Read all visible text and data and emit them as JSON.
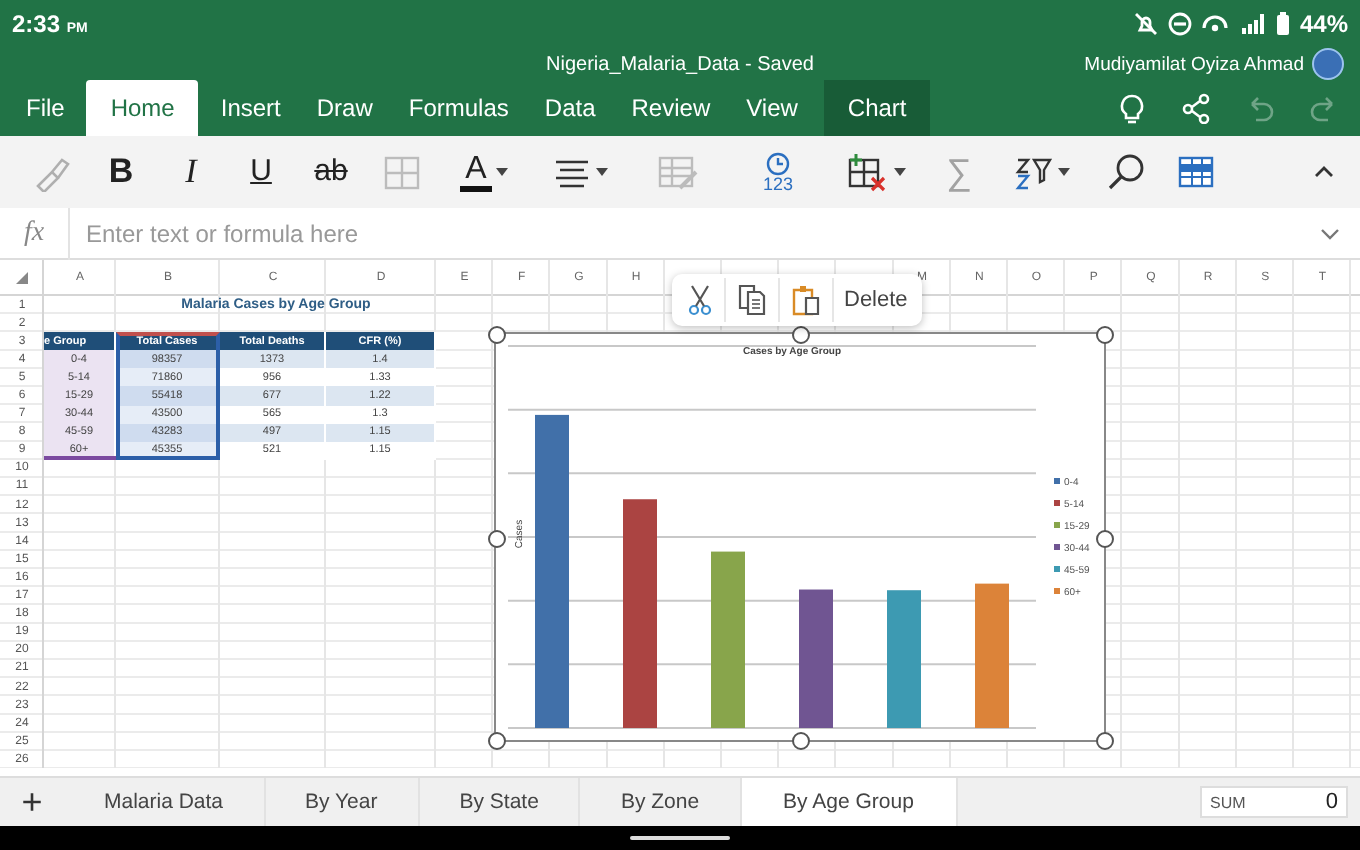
{
  "status_bar": {
    "time": "2:33",
    "meridiem": "PM",
    "battery": "44%"
  },
  "window": {
    "title": "Nigeria_Malaria_Data - Saved",
    "user": "Mudiyamilat Oyiza Ahmad"
  },
  "ribbon_tabs": [
    {
      "label": "File",
      "selected": false,
      "contextual": false
    },
    {
      "label": "Home",
      "selected": true,
      "contextual": false
    },
    {
      "label": "Insert",
      "selected": false,
      "contextual": false
    },
    {
      "label": "Draw",
      "selected": false,
      "contextual": false
    },
    {
      "label": "Formulas",
      "selected": false,
      "contextual": false
    },
    {
      "label": "Data",
      "selected": false,
      "contextual": false
    },
    {
      "label": "Review",
      "selected": false,
      "contextual": false
    },
    {
      "label": "View",
      "selected": false,
      "contextual": false
    },
    {
      "label": "Chart",
      "selected": false,
      "contextual": true
    }
  ],
  "header_actions": [
    {
      "kind": "ideas",
      "disabled": false
    },
    {
      "kind": "share",
      "disabled": false
    },
    {
      "kind": "undo",
      "disabled": true
    },
    {
      "kind": "redo",
      "disabled": true
    }
  ],
  "toolbar": [
    {
      "kind": "painter",
      "disabled": true
    },
    {
      "kind": "bold",
      "label": "B",
      "disabled": false
    },
    {
      "kind": "italic",
      "label": "I",
      "disabled": false
    },
    {
      "kind": "underline",
      "label": "U",
      "disabled": false
    },
    {
      "kind": "strike",
      "label": "ab",
      "disabled": false
    },
    {
      "kind": "borders",
      "disabled": true
    },
    {
      "kind": "font-color",
      "label": "A",
      "disabled": false,
      "dropdown": true
    },
    {
      "kind": "align",
      "disabled": false,
      "dropdown": true
    },
    {
      "kind": "format",
      "disabled": true
    },
    {
      "kind": "number-format",
      "label": "123",
      "disabled": false
    },
    {
      "kind": "insert-cells",
      "disabled": false,
      "dropdown": true
    },
    {
      "kind": "autosum",
      "label": "∑",
      "disabled": true
    },
    {
      "kind": "sort-filter",
      "disabled": false,
      "dropdown": true
    },
    {
      "kind": "find",
      "disabled": false
    },
    {
      "kind": "table",
      "disabled": false
    },
    {
      "kind": "collapse",
      "disabled": false
    }
  ],
  "formula_bar": {
    "label": "fx",
    "placeholder": "Enter text or formula here"
  },
  "sheet": {
    "columns": [
      {
        "label": "A"
      },
      {
        "label": "B"
      },
      {
        "label": "C"
      },
      {
        "label": "D"
      },
      {
        "label": "E"
      },
      {
        "label": "F"
      },
      {
        "label": "G"
      },
      {
        "label": "H"
      },
      {},
      {},
      {},
      {},
      {
        "label": "M"
      },
      {
        "label": "N"
      },
      {
        "label": "O"
      },
      {
        "label": "P"
      },
      {
        "label": "Q"
      },
      {
        "label": "R"
      },
      {
        "label": "S"
      },
      {
        "label": "T"
      }
    ],
    "rows": [
      "1",
      "2",
      "3",
      "4",
      "5",
      "6",
      "7",
      "8",
      "9",
      "10",
      "11",
      "12",
      "13",
      "14",
      "15",
      "16",
      "17",
      "18",
      "19",
      "20",
      "21",
      "22",
      "23",
      "24",
      "25",
      "26"
    ],
    "title": "Malaria Cases by Age Group",
    "table": {
      "header": [
        {
          "text": "e Group",
          "kind": "category"
        },
        {
          "text": "Total Cases",
          "kind": "values"
        },
        {
          "text": "Total Deaths",
          "kind": "plain"
        },
        {
          "text": "CFR (%)",
          "kind": "plain"
        }
      ],
      "rows": [
        [
          "0-4",
          "98357",
          "1373",
          "1.4"
        ],
        [
          "5-14",
          "71860",
          "956",
          "1.33"
        ],
        [
          "15-29",
          "55418",
          "677",
          "1.22"
        ],
        [
          "30-44",
          "43500",
          "565",
          "1.3"
        ],
        [
          "45-59",
          "43283",
          "497",
          "1.15"
        ],
        [
          "60+",
          "45355",
          "521",
          "1.15"
        ]
      ]
    }
  },
  "chart": {
    "selected": true,
    "title": "Cases by Age Group",
    "y_label": "Cases",
    "legend": [
      {
        "label": "0-4",
        "color": "#4170a9"
      },
      {
        "label": "5-14",
        "color": "#ab4442"
      },
      {
        "label": "15-29",
        "color": "#88a54b"
      },
      {
        "label": "30-44",
        "color": "#705592"
      },
      {
        "label": "45-59",
        "color": "#3d9ab2"
      },
      {
        "label": "60+",
        "color": "#dc8339"
      }
    ]
  },
  "context_menu": {
    "items": [
      {
        "kind": "cut"
      },
      {
        "kind": "copy"
      },
      {
        "kind": "paste"
      },
      {
        "kind": "text",
        "label": "Delete"
      }
    ]
  },
  "sheet_tabs": {
    "add": "+",
    "tabs": [
      {
        "label": "Malaria Data",
        "selected": false
      },
      {
        "label": "By Year",
        "selected": false
      },
      {
        "label": "By State",
        "selected": false
      },
      {
        "label": "By Zone",
        "selected": false
      },
      {
        "label": "By Age Group",
        "selected": true
      }
    ]
  },
  "sum_box": {
    "label": "SUM",
    "value": "0"
  }
}
